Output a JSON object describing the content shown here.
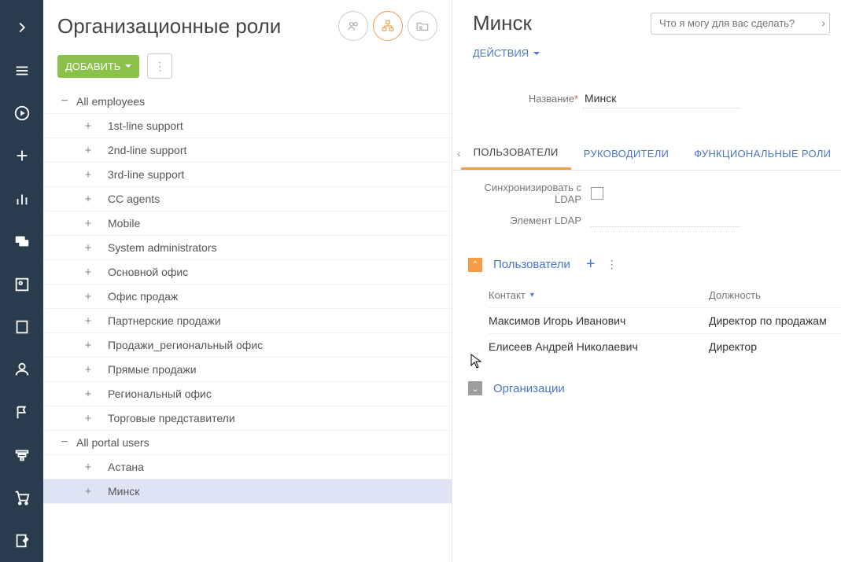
{
  "left": {
    "title": "Организационные роли",
    "add_btn": "ДОБАВИТЬ",
    "groups": [
      {
        "label": "All employees",
        "children": [
          "1st-line support",
          "2nd-line support",
          "3rd-line support",
          "CC agents",
          "Mobile",
          "System administrators",
          "Основной офис",
          "Офис продаж",
          "Партнерские продажи",
          "Продажи_региональный офис",
          "Прямые продажи",
          "Региональный офис",
          "Торговые представители"
        ]
      },
      {
        "label": "All portal users",
        "children": [
          "Астана",
          "Минск"
        ]
      }
    ],
    "selected": "Минск"
  },
  "right": {
    "title": "Минск",
    "search_placeholder": "Что я могу для вас сделать?",
    "actions_label": "ДЕЙСТВИЯ",
    "name_label": "Название",
    "name_value": "Минск",
    "tabs": [
      "ПОЛЬЗОВАТЕЛИ",
      "РУКОВОДИТЕЛИ",
      "ФУНКЦИОНАЛЬНЫЕ РОЛИ"
    ],
    "ldap_sync_label": "Синхронизировать с LDAP",
    "ldap_elem_label": "Элемент LDAP",
    "section_users": "Пользователи",
    "col_contact": "Контакт",
    "col_position": "Должность",
    "rows": [
      {
        "contact": "Максимов Игорь Иванович",
        "position": "Директор по продажам"
      },
      {
        "contact": "Елисеев Андрей Николаевич",
        "position": "Директор"
      }
    ],
    "section_orgs": "Организации"
  }
}
